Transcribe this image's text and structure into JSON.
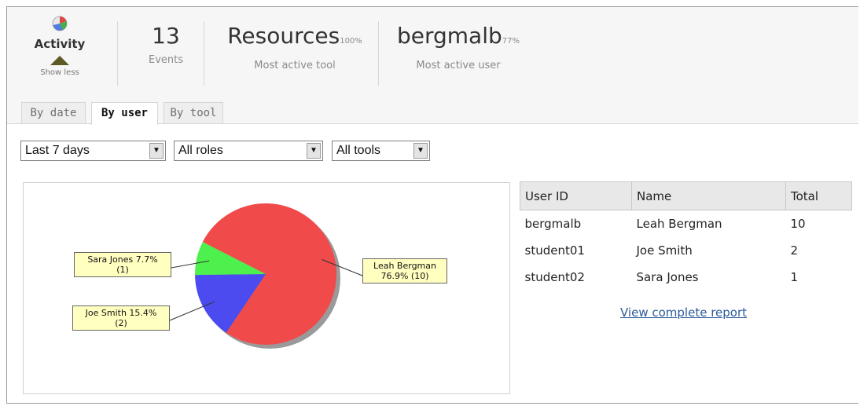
{
  "header": {
    "activity_label": "Activity",
    "show_less": "Show less",
    "stats": [
      {
        "value": "13",
        "pct": "",
        "caption": "Events"
      },
      {
        "value": "Resources",
        "pct": "100%",
        "caption": "Most active tool"
      },
      {
        "value": "bergmalb",
        "pct": "77%",
        "caption": "Most active user"
      }
    ]
  },
  "tabs": [
    {
      "label": "By date",
      "active": false
    },
    {
      "label": "By user",
      "active": true
    },
    {
      "label": "By tool",
      "active": false
    }
  ],
  "filters": {
    "period": "Last 7 days",
    "roles": "All roles",
    "tools": "All tools"
  },
  "chart_data": {
    "type": "pie",
    "slices": [
      {
        "label": "Leah Bergman",
        "value": 10,
        "percent": 76.9,
        "text_line1": "Leah Bergman",
        "text_line2": "76.9% (10)",
        "color": "#f04a4a"
      },
      {
        "label": "Joe Smith",
        "value": 2,
        "percent": 15.4,
        "text_line1": "Joe Smith 15.4%",
        "text_line2": "(2)",
        "color": "#4b4bf0"
      },
      {
        "label": "Sara Jones",
        "value": 1,
        "percent": 7.7,
        "text_line1": "Sara Jones 7.7%",
        "text_line2": "(1)",
        "color": "#4ef04e"
      }
    ],
    "legend": "none"
  },
  "table": {
    "columns": [
      "User ID",
      "Name",
      "Total"
    ],
    "rows": [
      [
        "bergmalb",
        "Leah Bergman",
        "10"
      ],
      [
        "student01",
        "Joe Smith",
        "2"
      ],
      [
        "student02",
        "Sara Jones",
        "1"
      ]
    ]
  },
  "report_link": "View complete report",
  "colors": {
    "accent_link": "#2c5a9a",
    "tooltip_bg": "#ffffc0",
    "header_bg": "#f6f6f6"
  }
}
